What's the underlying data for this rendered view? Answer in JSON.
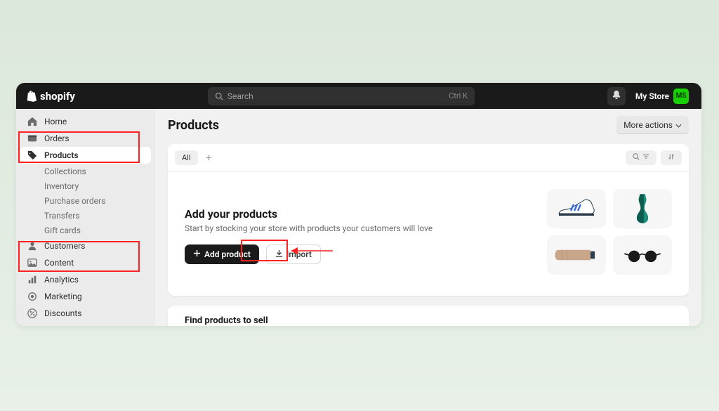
{
  "header": {
    "brand": "shopify",
    "search_placeholder": "Search",
    "search_shortcut": "Ctrl K",
    "store_label": "My Store",
    "avatar_initials": "MS"
  },
  "sidebar": {
    "items": [
      {
        "icon": "home",
        "label": "Home"
      },
      {
        "icon": "inbox",
        "label": "Orders"
      },
      {
        "icon": "tag",
        "label": "Products",
        "active": true
      },
      {
        "icon": "user",
        "label": "Customers"
      },
      {
        "icon": "image",
        "label": "Content"
      },
      {
        "icon": "bars",
        "label": "Analytics"
      },
      {
        "icon": "target",
        "label": "Marketing"
      },
      {
        "icon": "percent",
        "label": "Discounts"
      }
    ],
    "product_sub": [
      "Collections",
      "Inventory",
      "Purchase orders",
      "Transfers",
      "Gift cards"
    ]
  },
  "page": {
    "title": "Products",
    "more_actions_label": "More actions",
    "tab_all": "All",
    "empty": {
      "title": "Add your products",
      "subtitle": "Start by stocking your store with products your customers will love",
      "add_label": "Add product",
      "import_label": "Import"
    },
    "find_title": "Find products to sell"
  }
}
